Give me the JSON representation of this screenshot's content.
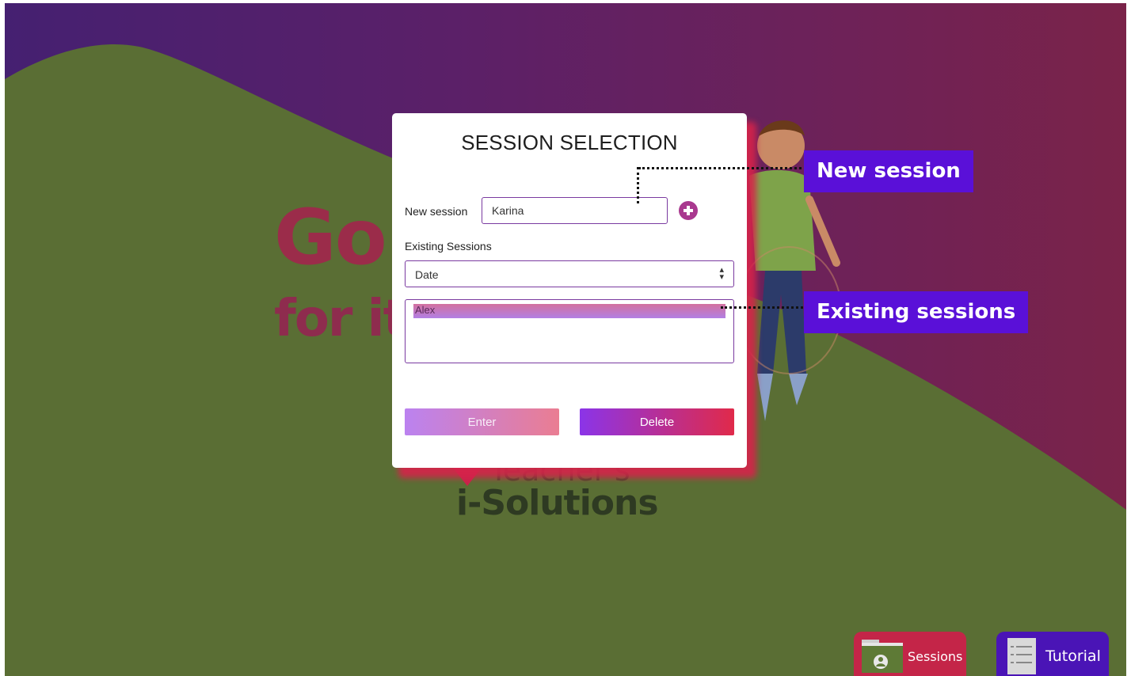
{
  "background": {
    "hero_line1": "Go",
    "hero_line2": "for it",
    "brand_line1": "Teacher's",
    "brand_line2": "i-Solutions"
  },
  "modal": {
    "title": "SESSION SELECTION",
    "new_session_label": "New session",
    "new_session_value": "Karina",
    "add_icon": "plus-circle-icon",
    "existing_label": "Existing Sessions",
    "sort_select": {
      "selected": "Date"
    },
    "sessions_list": [
      {
        "label": "Alex",
        "selected": true
      }
    ],
    "enter_label": "Enter",
    "delete_label": "Delete"
  },
  "callouts": {
    "new_session": "New session",
    "existing_sessions": "Existing sessions"
  },
  "bottom_nav": {
    "sessions_label": "Sessions",
    "sessions_icon": "folder-user-icon",
    "tutorial_label": "Tutorial",
    "tutorial_icon": "list-document-icon"
  },
  "colors": {
    "accent_purple": "#7a3aa0",
    "callout_bg": "#5a10d8",
    "sessions_nav": "#c42548",
    "tutorial_nav": "#4a14b6",
    "overlay_green": "#5a6e34"
  }
}
